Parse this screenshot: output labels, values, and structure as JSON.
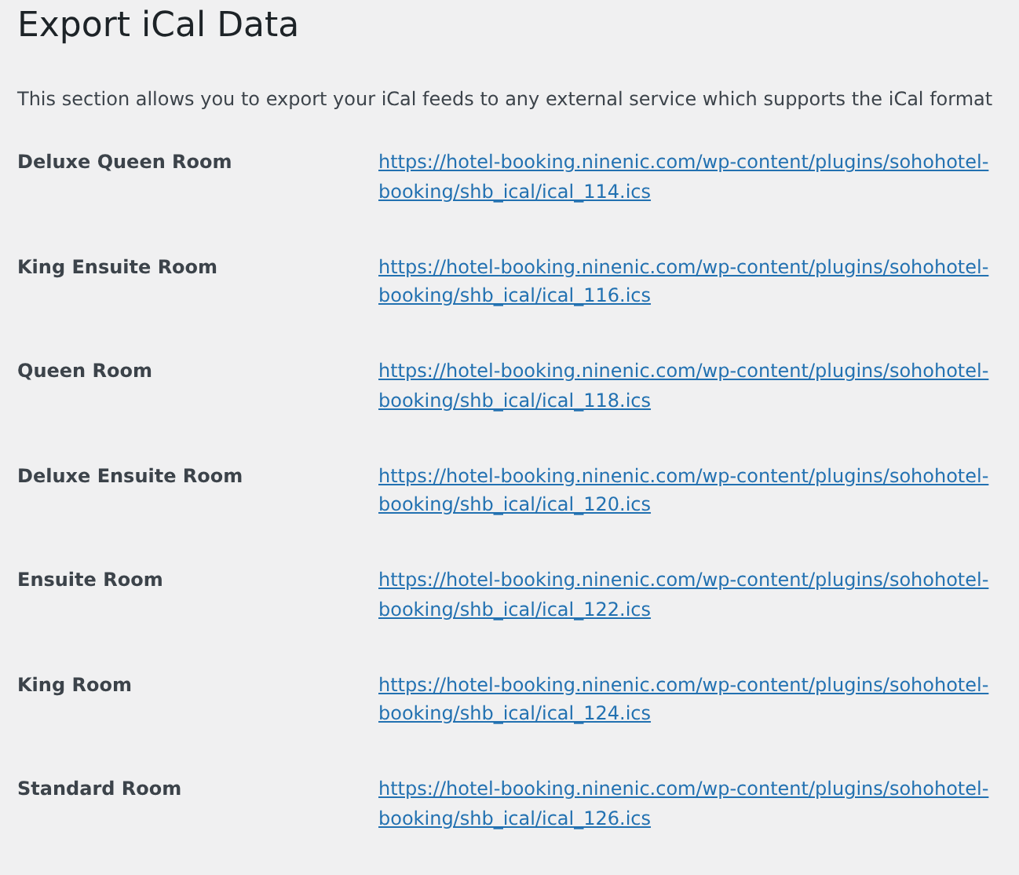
{
  "title": "Export iCal Data",
  "description": "This section allows you to export your iCal feeds to any external service which supports the iCal format",
  "rooms": [
    {
      "name": "Deluxe Queen Room",
      "url": "https://hotel-booking.ninenic.com/wp-content/plugins/sohohotel-booking/shb_ical/ical_114.ics"
    },
    {
      "name": "King Ensuite Room",
      "url": "https://hotel-booking.ninenic.com/wp-content/plugins/sohohotel-booking/shb_ical/ical_116.ics"
    },
    {
      "name": "Queen Room",
      "url": "https://hotel-booking.ninenic.com/wp-content/plugins/sohohotel-booking/shb_ical/ical_118.ics"
    },
    {
      "name": "Deluxe Ensuite Room",
      "url": "https://hotel-booking.ninenic.com/wp-content/plugins/sohohotel-booking/shb_ical/ical_120.ics"
    },
    {
      "name": "Ensuite Room",
      "url": "https://hotel-booking.ninenic.com/wp-content/plugins/sohohotel-booking/shb_ical/ical_122.ics"
    },
    {
      "name": "King Room",
      "url": "https://hotel-booking.ninenic.com/wp-content/plugins/sohohotel-booking/shb_ical/ical_124.ics"
    },
    {
      "name": "Standard Room",
      "url": "https://hotel-booking.ninenic.com/wp-content/plugins/sohohotel-booking/shb_ical/ical_126.ics"
    }
  ]
}
